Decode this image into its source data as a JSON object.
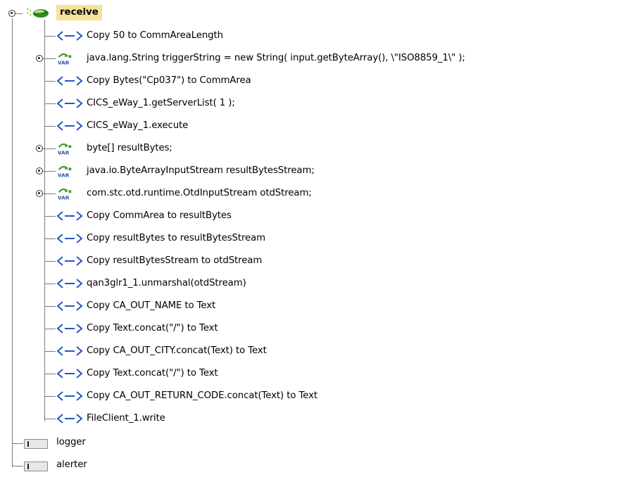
{
  "root": {
    "label": "receive",
    "icon": "service-leaf-icon"
  },
  "items": [
    {
      "kind": "copy",
      "label": "Copy 50 to CommAreaLength"
    },
    {
      "kind": "var",
      "label": "java.lang.String triggerString = new String( input.getByteArray(), \\\"ISO8859_1\\\" );"
    },
    {
      "kind": "copy",
      "label": "Copy Bytes(\"Cp037\") to CommArea"
    },
    {
      "kind": "copy",
      "label": "CICS_eWay_1.getServerList( 1 );"
    },
    {
      "kind": "copy",
      "label": "CICS_eWay_1.execute"
    },
    {
      "kind": "var",
      "label": "byte[] resultBytes;"
    },
    {
      "kind": "var",
      "label": "java.io.ByteArrayInputStream resultBytesStream;"
    },
    {
      "kind": "var",
      "label": "com.stc.otd.runtime.OtdInputStream otdStream;"
    },
    {
      "kind": "copy",
      "label": "Copy CommArea to resultBytes"
    },
    {
      "kind": "copy",
      "label": "Copy resultBytes to resultBytesStream"
    },
    {
      "kind": "copy",
      "label": "Copy resultBytesStream to otdStream"
    },
    {
      "kind": "copy",
      "label": "qan3glr1_1.unmarshal(otdStream)"
    },
    {
      "kind": "copy",
      "label": "Copy CA_OUT_NAME to Text"
    },
    {
      "kind": "copy",
      "label": "Copy Text.concat(\"/\") to Text"
    },
    {
      "kind": "copy",
      "label": "Copy CA_OUT_CITY.concat(Text) to Text"
    },
    {
      "kind": "copy",
      "label": "Copy Text.concat(\"/\") to Text"
    },
    {
      "kind": "copy",
      "label": "Copy CA_OUT_RETURN_CODE.concat(Text) to Text"
    },
    {
      "kind": "copy",
      "label": "FileClient_1.write"
    }
  ],
  "siblings": [
    {
      "label": "logger",
      "icon": "component-icon"
    },
    {
      "label": "alerter",
      "icon": "component-icon"
    }
  ],
  "colors": {
    "copyIcon": "#1f56c8",
    "varGreen": "#3f9b2a",
    "varText": "#2a52a8",
    "selection": "#f7e29a"
  }
}
